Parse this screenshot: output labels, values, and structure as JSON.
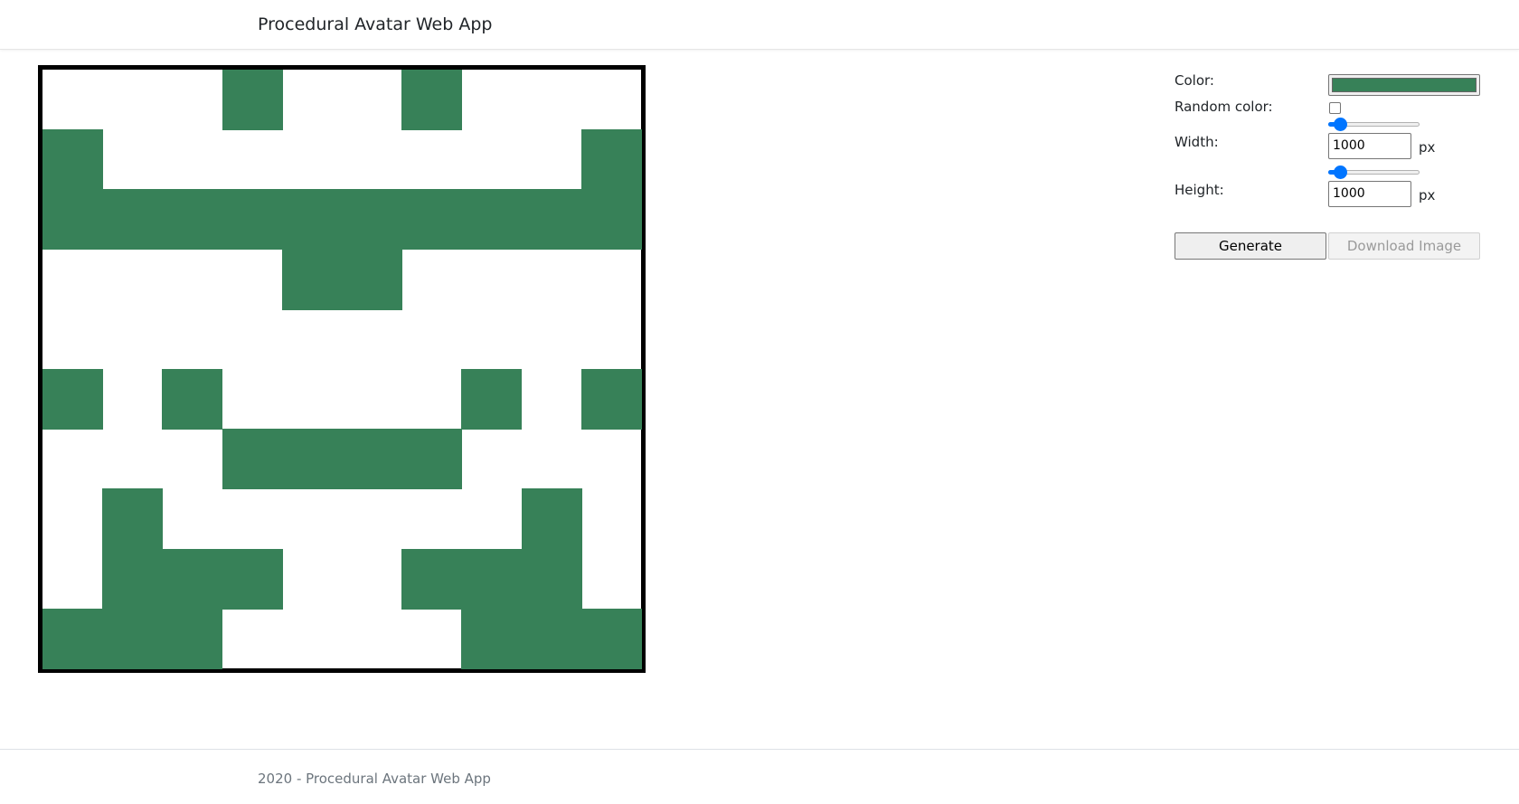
{
  "header": {
    "brand": "Procedural Avatar Web App"
  },
  "avatar": {
    "color": "#378158",
    "border_color": "#000000",
    "grid_size": 10,
    "rows": [
      "0001001000",
      "1000000001",
      "1111111111",
      "0000110000",
      "0000000000",
      "1010000101",
      "0001111000",
      "0100000010",
      "0111001110",
      "1110000111"
    ]
  },
  "controls": {
    "color_label": "Color:",
    "color_value": "#378158",
    "random_color_label": "Random color:",
    "random_color_checked": false,
    "width_label": "Width:",
    "width_value": "1000",
    "width_unit": "px",
    "width_slider_fraction": 0.13,
    "height_label": "Height:",
    "height_value": "1000",
    "height_unit": "px",
    "height_slider_fraction": 0.13,
    "generate_label": "Generate",
    "download_label": "Download Image"
  },
  "footer": {
    "text": "2020 - Procedural Avatar Web App"
  }
}
